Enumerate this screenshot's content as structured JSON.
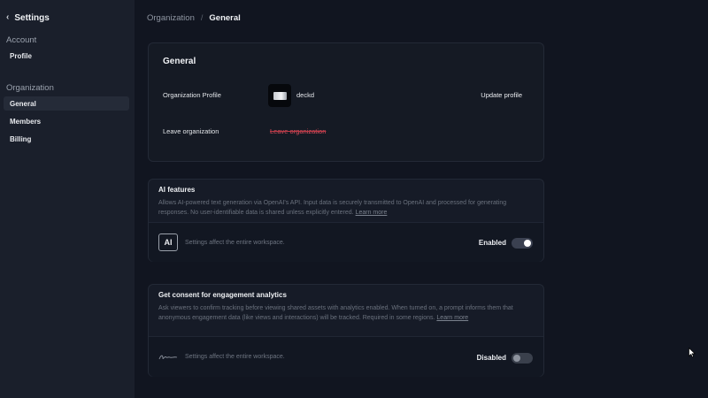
{
  "sidebar": {
    "back_label": "Settings",
    "sections": [
      {
        "title": "Account",
        "items": [
          {
            "label": "Profile"
          }
        ]
      },
      {
        "title": "Organization",
        "items": [
          {
            "label": "General",
            "active": true
          },
          {
            "label": "Members"
          },
          {
            "label": "Billing"
          }
        ]
      }
    ]
  },
  "breadcrumb": {
    "parent": "Organization",
    "current": "General"
  },
  "general_card": {
    "title": "General",
    "org_profile_label": "Organization Profile",
    "org_name": "deckd",
    "update_profile": "Update profile",
    "leave_label": "Leave organization",
    "leave_action": "Leave organization"
  },
  "ai_features": {
    "title": "AI features",
    "description": "Allows AI-powered text generation via OpenAI's API. Input data is securely transmitted to OpenAI and processed for generating responses. No user-identifiable data is shared unless explicitly entered.",
    "learn_more": "Learn more",
    "badge": "AI",
    "note": "Settings affect the entire workspace.",
    "status_label": "Enabled",
    "enabled": true
  },
  "consent": {
    "title": "Get consent for engagement analytics",
    "description": "Ask viewers to confirm tracking before viewing shared assets with analytics enabled. When turned on, a prompt informs them that anonymous engagement data (like views and interactions) will be tracked. Required in some regions.",
    "learn_more": "Learn more",
    "note": "Settings affect the entire workspace.",
    "status_label": "Disabled",
    "enabled": false
  },
  "colors": {
    "background": "#111520",
    "sidebar": "#1a1f2b",
    "danger": "#e0505f",
    "toggle_on_knob": "#ffffff"
  }
}
